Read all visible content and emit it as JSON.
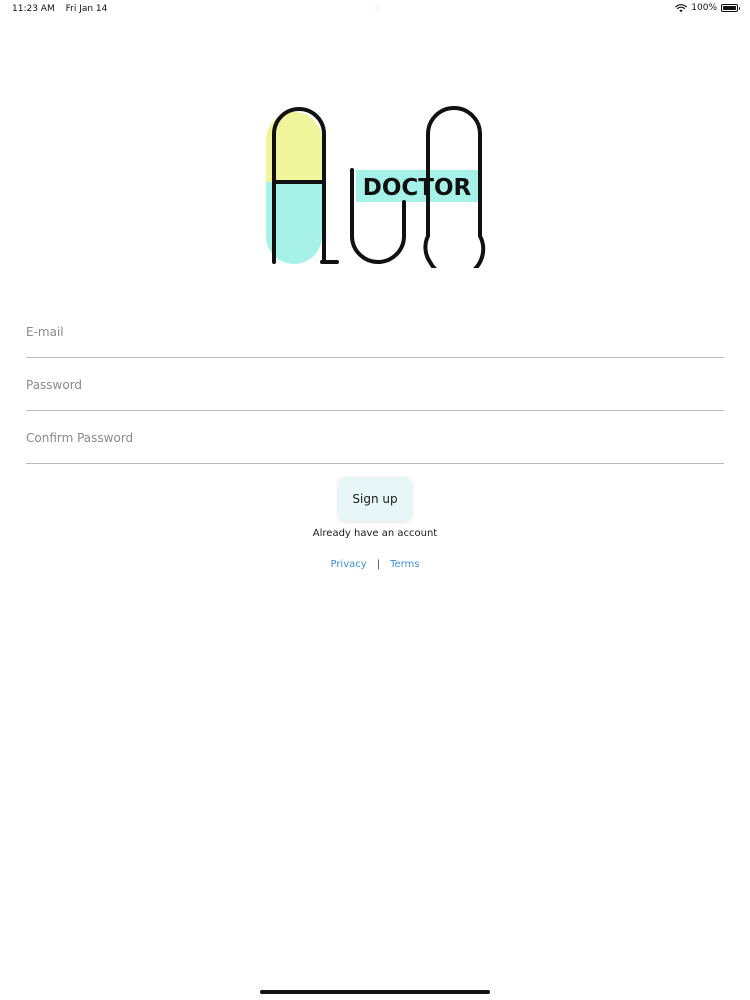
{
  "status_bar": {
    "time": "11:23 AM",
    "date": "Fri Jan 14",
    "battery": "100%",
    "icons": [
      "wifi-icon",
      "battery-icon"
    ]
  },
  "logo": {
    "text": "DOCTOR",
    "colors": {
      "yellow": "#eef59a",
      "cyan": "#a6f2e8",
      "ink": "#111111"
    }
  },
  "form": {
    "email": {
      "value": "",
      "placeholder": "E-mail"
    },
    "password": {
      "value": "",
      "placeholder": "Password"
    },
    "confirm_password": {
      "value": "",
      "placeholder": "Confirm Password"
    }
  },
  "signup_label": "Sign up",
  "login_link": "Already have an account",
  "legal": {
    "privacy": "Privacy",
    "separator": "|",
    "terms": "Terms",
    "link_color": "#3d8fc9"
  },
  "button_color": "#e7f6f6"
}
